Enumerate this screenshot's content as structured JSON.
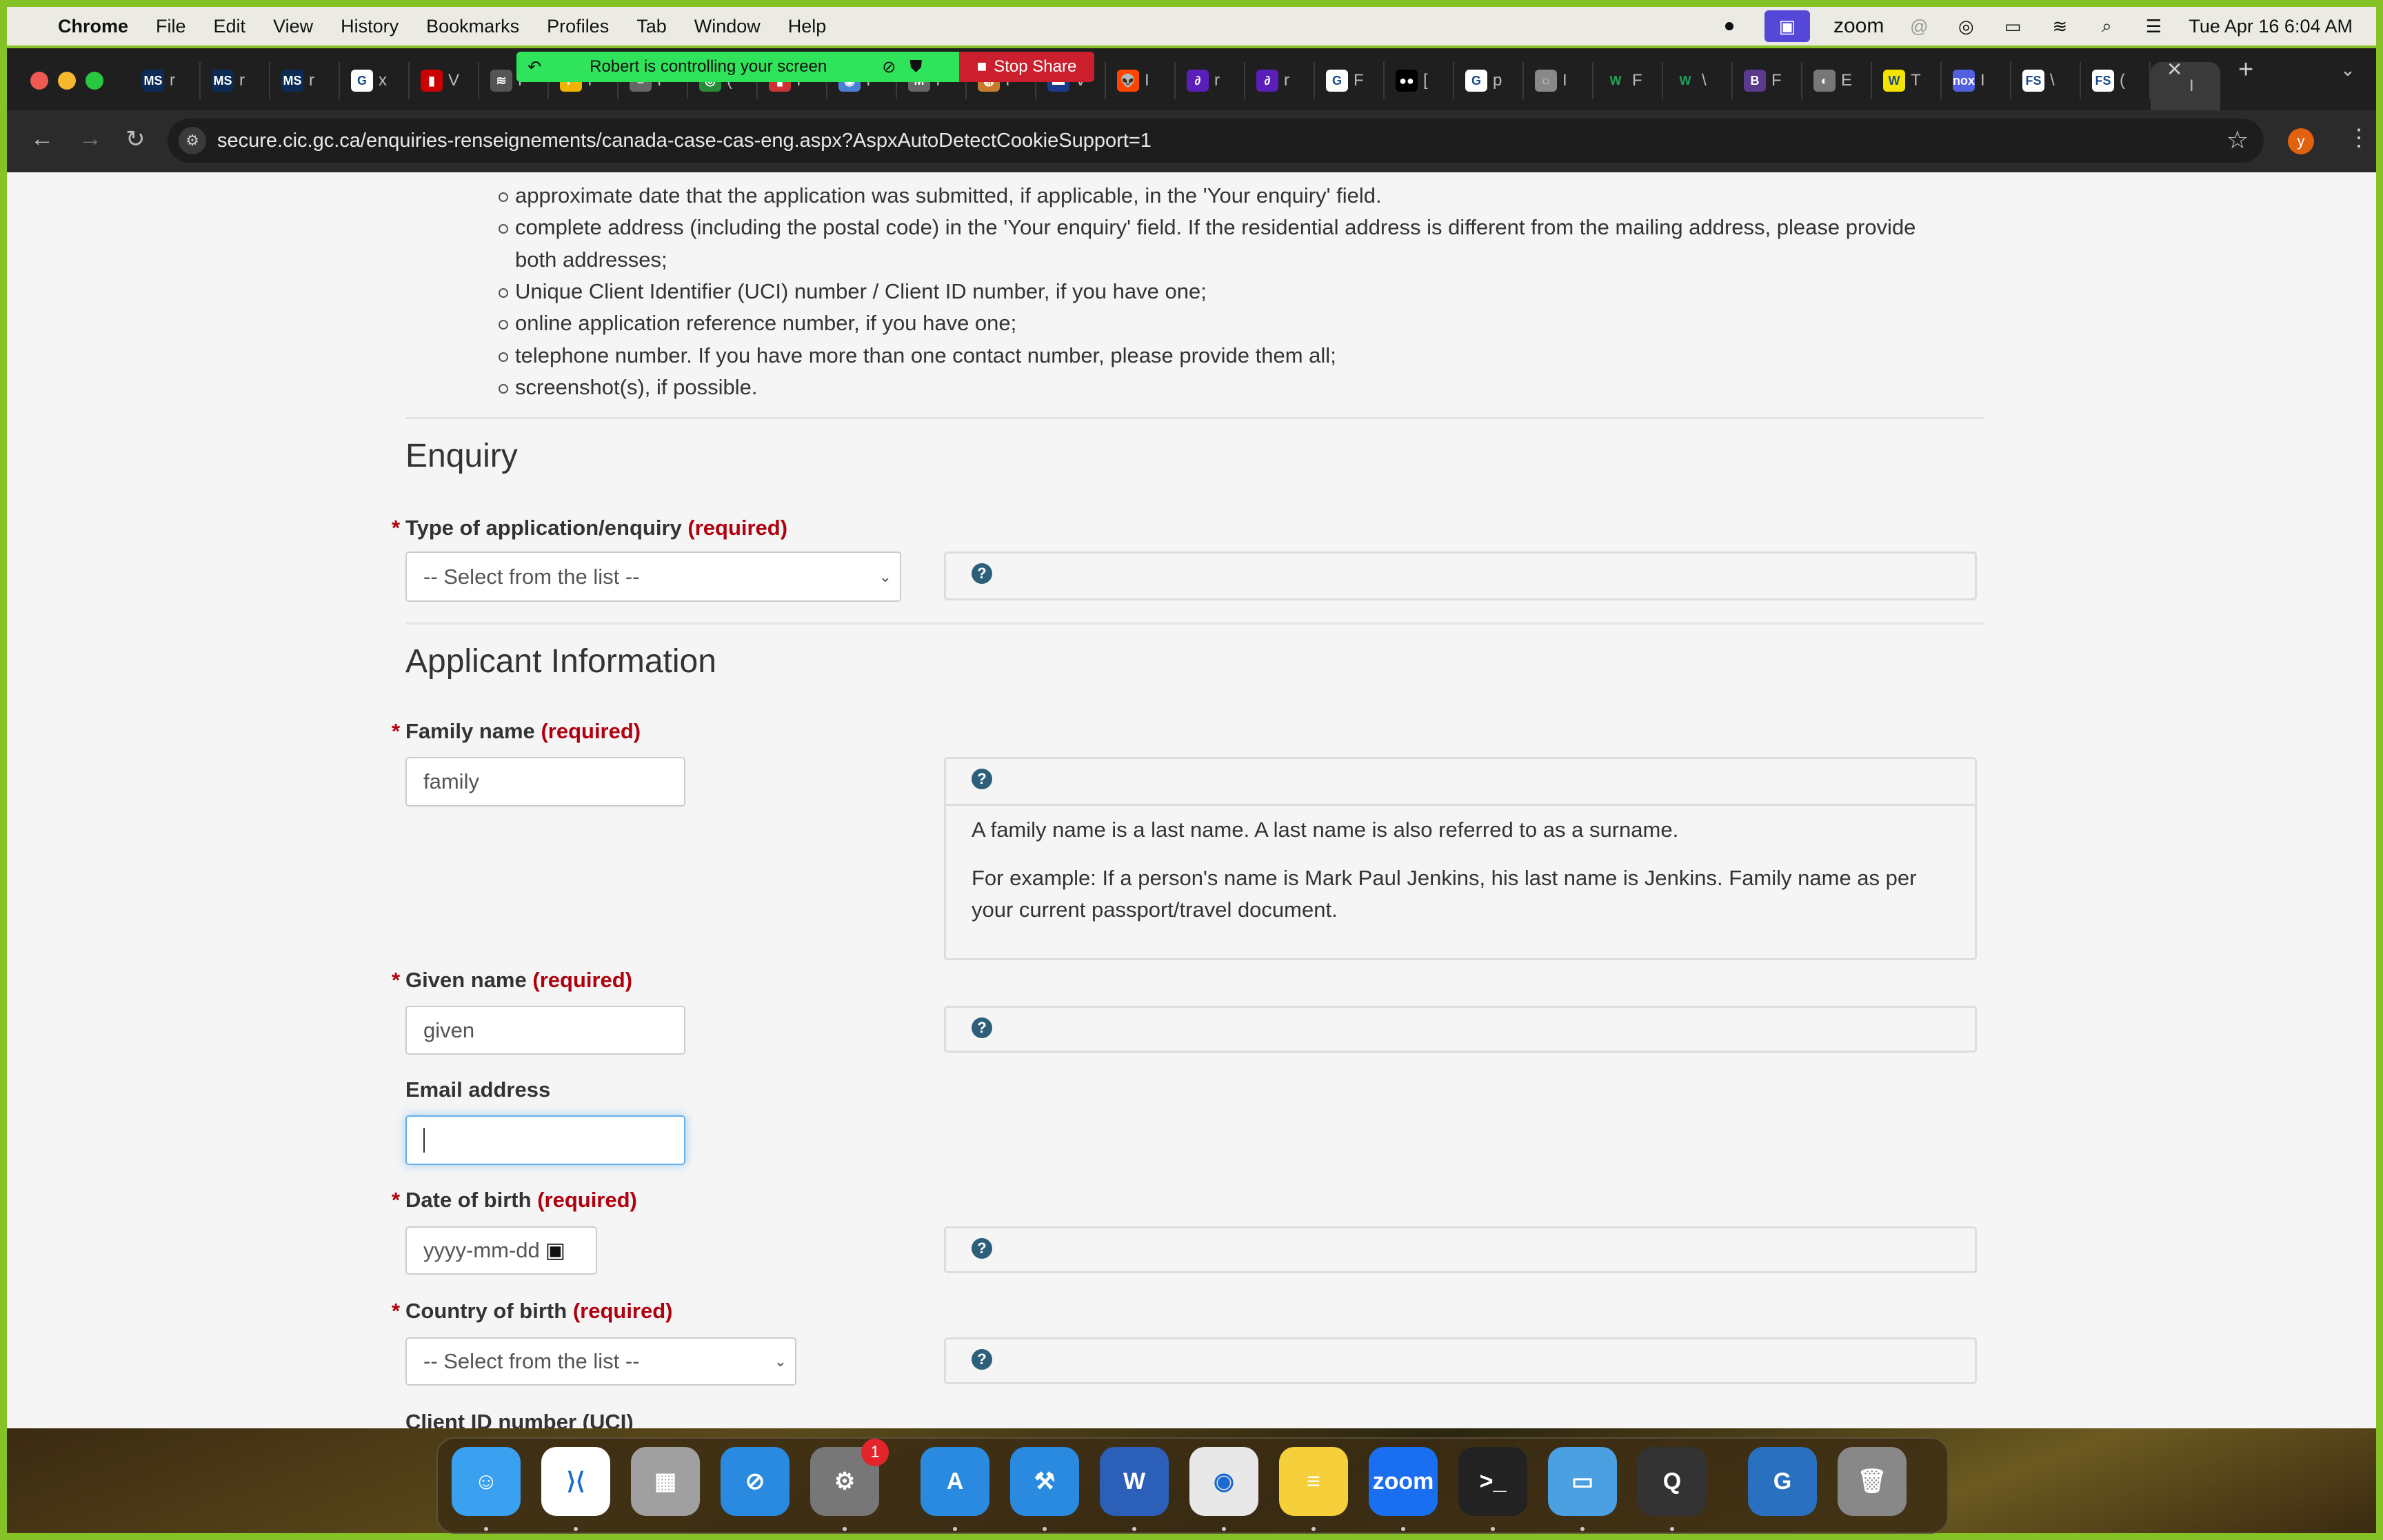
{
  "menubar": {
    "app": "Chrome",
    "items": [
      "File",
      "Edit",
      "View",
      "History",
      "Bookmarks",
      "Profiles",
      "Tab",
      "Window",
      "Help"
    ],
    "zoom_label": "zoom",
    "datetime": "Tue Apr 16  6:04 AM"
  },
  "zoom_banner": {
    "message": "Robert is controlling your screen",
    "stop_label": "Stop Share",
    "green": "#2fe35a",
    "red": "#cc1f2e"
  },
  "tabs": [
    {
      "icon": "MS",
      "color": "#0b2a55",
      "title": "r"
    },
    {
      "icon": "MS",
      "color": "#0b2a55",
      "title": "r"
    },
    {
      "icon": "MS",
      "color": "#0b2a55",
      "title": "r"
    },
    {
      "icon": "G",
      "color": "#ffffff",
      "title": "x"
    },
    {
      "icon": "▮",
      "color": "#c00",
      "title": "V"
    },
    {
      "icon": "≋",
      "color": "#555",
      "title": "F"
    },
    {
      "icon": "P",
      "color": "#f0b400",
      "title": "I"
    },
    {
      "icon": "≡",
      "color": "#666",
      "title": "F"
    },
    {
      "icon": "◎",
      "color": "#2a8a3a",
      "title": "("
    },
    {
      "icon": "▮",
      "color": "#c33",
      "title": "I"
    },
    {
      "icon": "◉",
      "color": "#4a7fd8",
      "title": "I"
    },
    {
      "icon": "M",
      "color": "#666",
      "title": "I"
    },
    {
      "icon": "◍",
      "color": "#c77a2a",
      "title": "I"
    },
    {
      "icon": "▬",
      "color": "#1a3a8a",
      "title": "V"
    },
    {
      "icon": "👽",
      "color": "#ff4500",
      "title": "I"
    },
    {
      "icon": "∂",
      "color": "#5a1fb8",
      "title": "r"
    },
    {
      "icon": "∂",
      "color": "#5a1fb8",
      "title": "r"
    },
    {
      "icon": "G",
      "color": "#ffffff",
      "title": "F"
    },
    {
      "icon": "●●",
      "color": "#000",
      "title": "["
    },
    {
      "icon": "G",
      "color": "#ffffff",
      "title": "p"
    },
    {
      "icon": "◌",
      "color": "#888",
      "title": "I"
    },
    {
      "icon": "W",
      "color": "#1f1f1f",
      "title": "F"
    },
    {
      "icon": "W",
      "color": "#1f1f1f",
      "title": "\\"
    },
    {
      "icon": "B",
      "color": "#5a3a8a",
      "title": "F"
    },
    {
      "icon": "◐",
      "color": "#777",
      "title": "E"
    },
    {
      "icon": "W",
      "color": "#f5e300",
      "title": "T"
    },
    {
      "icon": "nox",
      "color": "#5060e0",
      "title": "I"
    },
    {
      "icon": "FS",
      "color": "#ffffff",
      "title": "\\"
    },
    {
      "icon": "FS",
      "color": "#ffffff",
      "title": "("
    },
    {
      "icon": "",
      "color": "#3a3a3a",
      "title": "I"
    }
  ],
  "address": {
    "url": "secure.cic.gc.ca/enquiries-renseignements/canada-case-cas-eng.aspx?AspxAutoDetectCookieSupport=1",
    "avatar_letter": "y"
  },
  "content": {
    "bullets": [
      "approximate date that the application was submitted, if applicable, in the 'Your enquiry' field.",
      "complete address (including the postal code) in the 'Your enquiry' field. If the residential address is different from the mailing address, please provide",
      "both addresses;",
      "Unique Client Identifier (UCI) number / Client ID number, if you have one;",
      "online application reference number, if you have one;",
      "telephone number. If you have more than one contact number, please provide them all;",
      "screenshot(s), if possible."
    ],
    "enquiry_heading": "Enquiry",
    "applicant_heading": "Applicant Information",
    "required_marker": "*",
    "required_text": "(required)",
    "help_icon": "?",
    "fields": {
      "type": {
        "label": "Type of application/enquiry",
        "value": "-- Select from the list --"
      },
      "family": {
        "label": "Family name",
        "value": "family",
        "help": [
          "A family name is a last name. A last name is also referred to as a surname.",
          "For example: If a person's name is Mark Paul Jenkins, his last name is Jenkins. Family name as per your current passport/travel document."
        ]
      },
      "given": {
        "label": "Given name",
        "value": "given"
      },
      "email": {
        "label": "Email address",
        "value": ""
      },
      "dob": {
        "label": "Date of birth",
        "placeholder": "yyyy-mm-dd"
      },
      "country": {
        "label": "Country of birth",
        "value": "-- Select from the list --"
      },
      "uci": {
        "label": "Client ID number (UCI)"
      }
    }
  },
  "dock": [
    {
      "name": "finder",
      "glyph": "☺",
      "color": "#3aa0f0"
    },
    {
      "name": "vscode",
      "glyph": "⟩⟨",
      "color": "#ffffff"
    },
    {
      "name": "launchpad",
      "glyph": "▦",
      "color": "#a0a0a0"
    },
    {
      "name": "safari",
      "glyph": "⊘",
      "color": "#2a8ae0"
    },
    {
      "name": "system-settings",
      "glyph": "⚙",
      "color": "#777",
      "badge": "1"
    },
    {
      "name": "app-store",
      "glyph": "A",
      "color": "#2a8ae0"
    },
    {
      "name": "xcode",
      "glyph": "⚒",
      "color": "#2a8ae0"
    },
    {
      "name": "word",
      "glyph": "W",
      "color": "#2b5fb8"
    },
    {
      "name": "chrome",
      "glyph": "◉",
      "color": "#e8e8e8"
    },
    {
      "name": "notes",
      "glyph": "≡",
      "color": "#f5d03a"
    },
    {
      "name": "zoom",
      "glyph": "zoom",
      "color": "#1a6ff0"
    },
    {
      "name": "terminal",
      "glyph": ">_",
      "color": "#222"
    },
    {
      "name": "screen",
      "glyph": "▭",
      "color": "#4aa0e0"
    },
    {
      "name": "quicktime",
      "glyph": "Q",
      "color": "#333"
    },
    {
      "name": "downloads",
      "glyph": "G",
      "color": "#2a70c0"
    },
    {
      "name": "trash",
      "glyph": "🗑",
      "color": "#888"
    }
  ]
}
